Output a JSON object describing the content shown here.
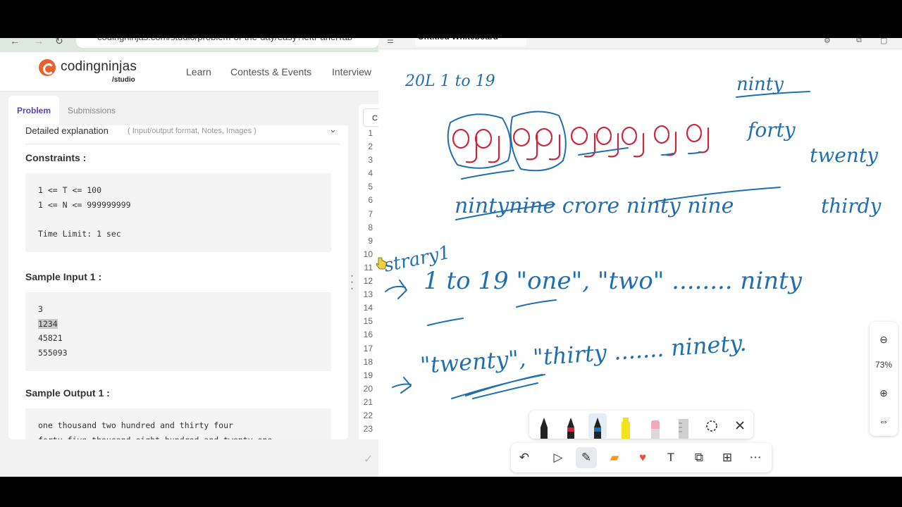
{
  "browser": {
    "url": "codingninjas.com/studio/problem-of-the-day/easy?leftPanelTab",
    "back_glyph": "←",
    "forward_glyph": "→",
    "reload_glyph": "↻"
  },
  "app": {
    "logo_name": "codingninjas",
    "logo_sub": "/studio",
    "nav": [
      "Learn",
      "Contests & Events",
      "Interview"
    ]
  },
  "tabs": [
    "Problem",
    "Submissions"
  ],
  "detail": {
    "title": "Detailed explanation",
    "subtitle": "( Input/output format, Notes, Images )"
  },
  "constraints": {
    "title": "Constraints :",
    "lines": [
      "1 <= T <= 100",
      "1 <= N <= 999999999",
      "",
      "Time Limit: 1 sec"
    ]
  },
  "sample_input": {
    "title": "Sample Input 1 :",
    "lines": [
      "3",
      "1234",
      "45821",
      "555093"
    ]
  },
  "sample_output": {
    "title": "Sample Output 1 :",
    "lines": [
      "one thousand two hundred and thirty four",
      "forty five thousand eight hundred and twenty one"
    ]
  },
  "editor": {
    "language": "C+",
    "line_numbers": [
      "1",
      "2",
      "3",
      "4",
      "5",
      "6",
      "7",
      "8",
      "9",
      "10",
      "11",
      "12",
      "13",
      "14",
      "15",
      "16",
      "17",
      "18",
      "19",
      "20",
      "21",
      "22",
      "23"
    ]
  },
  "whiteboard": {
    "title": "Untitled Whiteboard",
    "zoom": "73%",
    "zoom_out_glyph": "⊖",
    "zoom_in_glyph": "⊕",
    "fit_glyph": "⇔",
    "ink_text": {
      "top_left": "20L  1 to 19",
      "digits": "9 9 9 9 9 9 9 9 9",
      "line2": "nintynine crore ninty nine",
      "side_words": [
        "ninty",
        "forty",
        "twenty",
        "thirdy"
      ],
      "strat": "strary1",
      "line3": "1  to  19 \"one\", \"two\" ........ ninty",
      "line4": "\"twenty\", \"thirty ....... ninety."
    },
    "colors": {
      "ink_blue": "#1f6fb0",
      "ink_red": "#c8283a"
    }
  },
  "tools": {
    "undo": "↶",
    "select": "▷",
    "pen": "✎",
    "sticky": "▰",
    "reaction": "♥",
    "text": "T",
    "shapes": "⧉",
    "template": "⊞",
    "more": "⋯"
  }
}
